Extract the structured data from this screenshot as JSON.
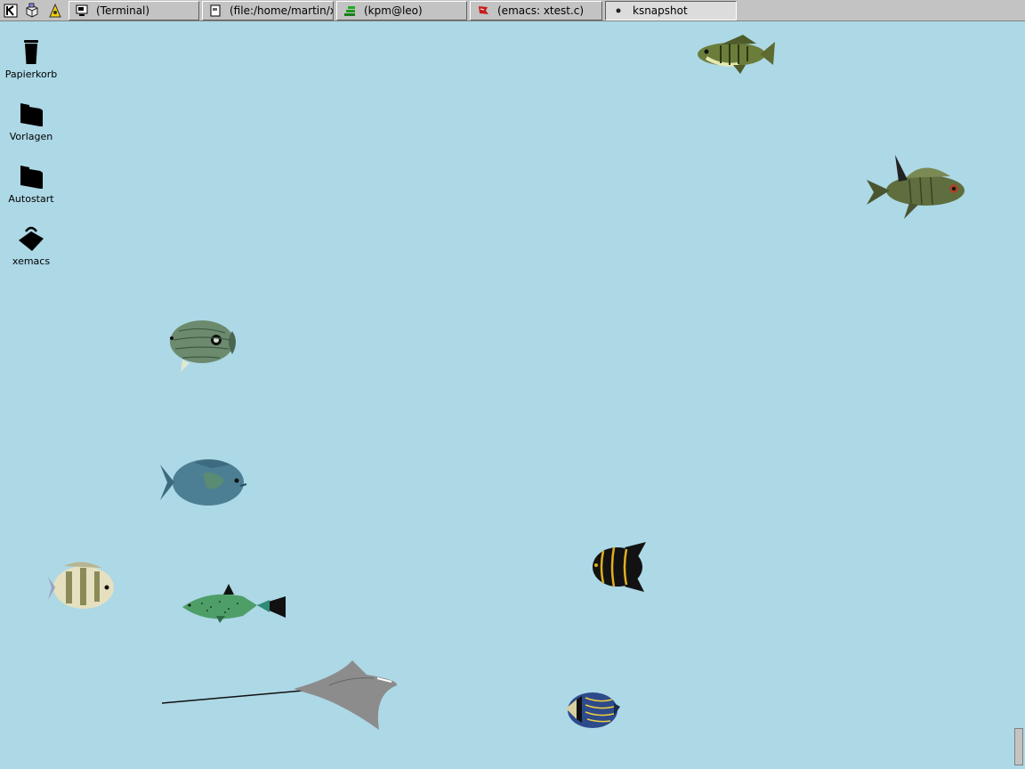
{
  "taskbar": {
    "quick_launch": [
      {
        "icon": "kde-k-icon"
      },
      {
        "icon": "package-icon"
      },
      {
        "icon": "wizard-icon"
      }
    ],
    "tasks": [
      {
        "label": "(Terminal)",
        "icon": "terminal-icon",
        "active": false
      },
      {
        "label": "(file:/home/martin/x...",
        "icon": "file-manager-icon",
        "active": false
      },
      {
        "label": "(kpm@leo)",
        "icon": "process-monitor-icon",
        "active": false
      },
      {
        "label": "(emacs: xtest.c)",
        "icon": "emacs-icon",
        "active": false
      },
      {
        "label": "ksnapshot",
        "icon": "camera-icon",
        "active": true
      }
    ]
  },
  "desktop": {
    "background_color": "#add8e6",
    "icons": [
      {
        "label": "Papierkorb",
        "icon": "trash-icon"
      },
      {
        "label": "Vorlagen",
        "icon": "folder-icon"
      },
      {
        "label": "Autostart",
        "icon": "folder-icon"
      },
      {
        "label": "xemacs",
        "icon": "xemacs-icon"
      }
    ]
  }
}
